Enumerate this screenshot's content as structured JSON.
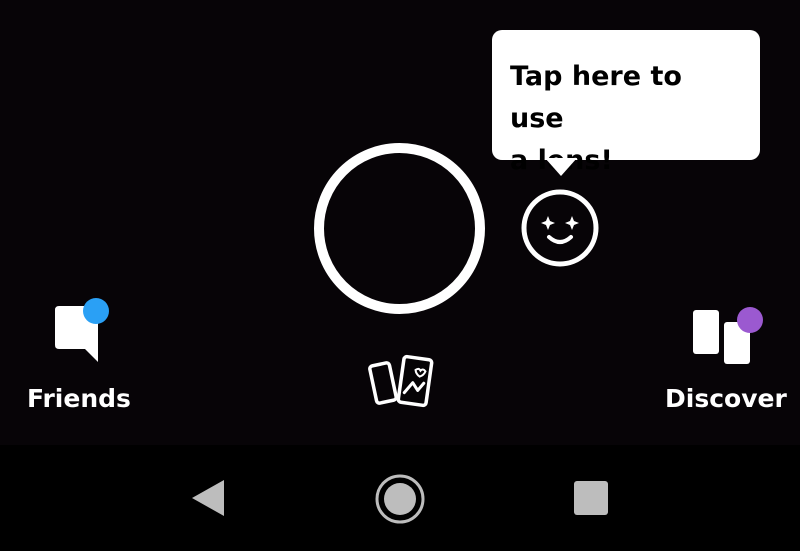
{
  "tooltip": {
    "line1": "Tap here to use",
    "line2": "a lens!"
  },
  "bottom_nav": {
    "friends_label": "Friends",
    "discover_label": "Discover"
  },
  "icons": {
    "capture": "capture-ring",
    "lens": "smiley-sparkle-icon",
    "friends": "chat-bubble-icon",
    "discover": "discover-cards-icon",
    "memories": "memories-cards-icon",
    "back": "triangle-back-icon",
    "home": "circle-home-icon",
    "recents": "square-recents-icon"
  },
  "colors": {
    "background": "#050305",
    "foreground": "#ffffff",
    "friends_badge": "#2aa0f5",
    "discover_badge": "#9b59d0",
    "android_nav": "#bdbdbd"
  }
}
